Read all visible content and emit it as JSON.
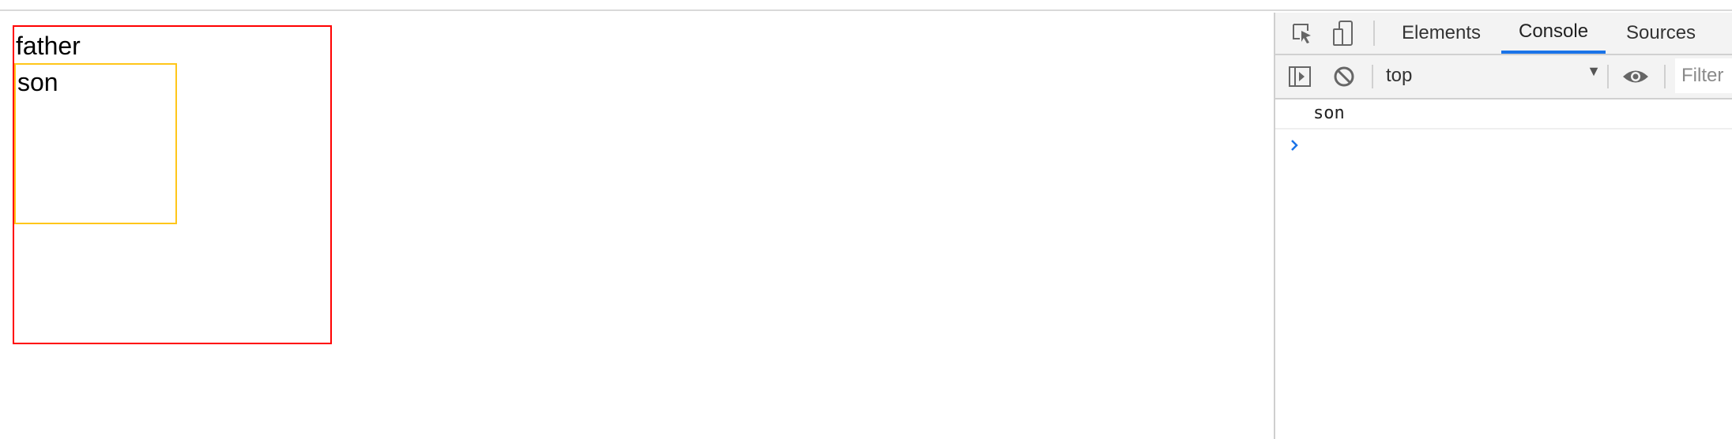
{
  "page": {
    "father_text": "father",
    "son_text": "son",
    "father_border_color": "#ff0000",
    "son_border_color": "#ffc61a"
  },
  "devtools": {
    "tabs": [
      {
        "label": "Elements",
        "active": false
      },
      {
        "label": "Console",
        "active": true
      },
      {
        "label": "Sources",
        "active": false
      }
    ],
    "toolbar": {
      "context": "top",
      "filter_placeholder": "Filter"
    },
    "console": {
      "messages": [
        "son"
      ]
    },
    "icons": [
      "inspect-element-icon",
      "device-toolbar-icon",
      "sidebar-toggle-icon",
      "clear-console-icon",
      "eye-icon",
      "chevron-right-icon"
    ],
    "accent_color": "#1a73e8"
  }
}
